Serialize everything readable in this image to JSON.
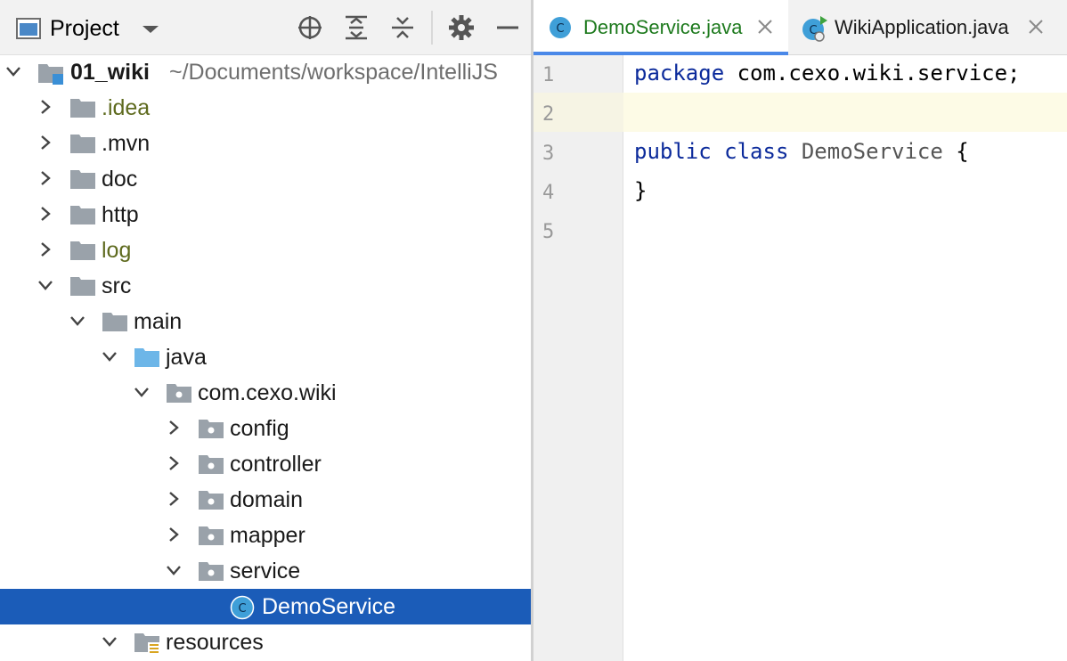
{
  "project_pane": {
    "title": "Project",
    "toolbar_icons": [
      "locate-icon",
      "expand-all-icon",
      "collapse-all-icon",
      "gear-icon",
      "minimize-icon"
    ]
  },
  "tree": {
    "root_name": "01_wiki",
    "root_path": "~/Documents/workspace/IntelliJS",
    "items": [
      {
        "label": ".idea",
        "state": "collapsed"
      },
      {
        "label": ".mvn",
        "state": "collapsed"
      },
      {
        "label": "doc",
        "state": "collapsed"
      },
      {
        "label": "http",
        "state": "collapsed"
      },
      {
        "label": "log",
        "state": "collapsed"
      },
      {
        "label": "src",
        "state": "expanded"
      },
      {
        "label": "main",
        "state": "expanded"
      },
      {
        "label": "java",
        "state": "expanded"
      },
      {
        "label": "com.cexo.wiki",
        "state": "expanded"
      },
      {
        "label": "config",
        "state": "collapsed"
      },
      {
        "label": "controller",
        "state": "collapsed"
      },
      {
        "label": "domain",
        "state": "collapsed"
      },
      {
        "label": "mapper",
        "state": "collapsed"
      },
      {
        "label": "service",
        "state": "expanded"
      },
      {
        "label": "DemoService",
        "state": "selected"
      },
      {
        "label": "resources",
        "state": "expanded"
      }
    ]
  },
  "editor": {
    "tabs": [
      {
        "label": "DemoService.java",
        "active": true
      },
      {
        "label": "WikiApplication.java",
        "active": false
      }
    ],
    "line_numbers": [
      "1",
      "2",
      "3",
      "4",
      "5"
    ],
    "code": {
      "l1_kw": "package",
      "l1_rest": " com.cexo.wiki.service;",
      "l3_kw1": "public",
      "l3_kw2": "class",
      "l3_cls": "DemoService",
      "l3_rest": " {",
      "l4": "}"
    }
  },
  "colors": {
    "selection": "#1b5cb8",
    "active_tab_text": "#1e7a1e",
    "keyword": "#0b2a9b",
    "excluded_folder_text": "#5e6a1e",
    "caret_line": "#fdfbe6"
  }
}
